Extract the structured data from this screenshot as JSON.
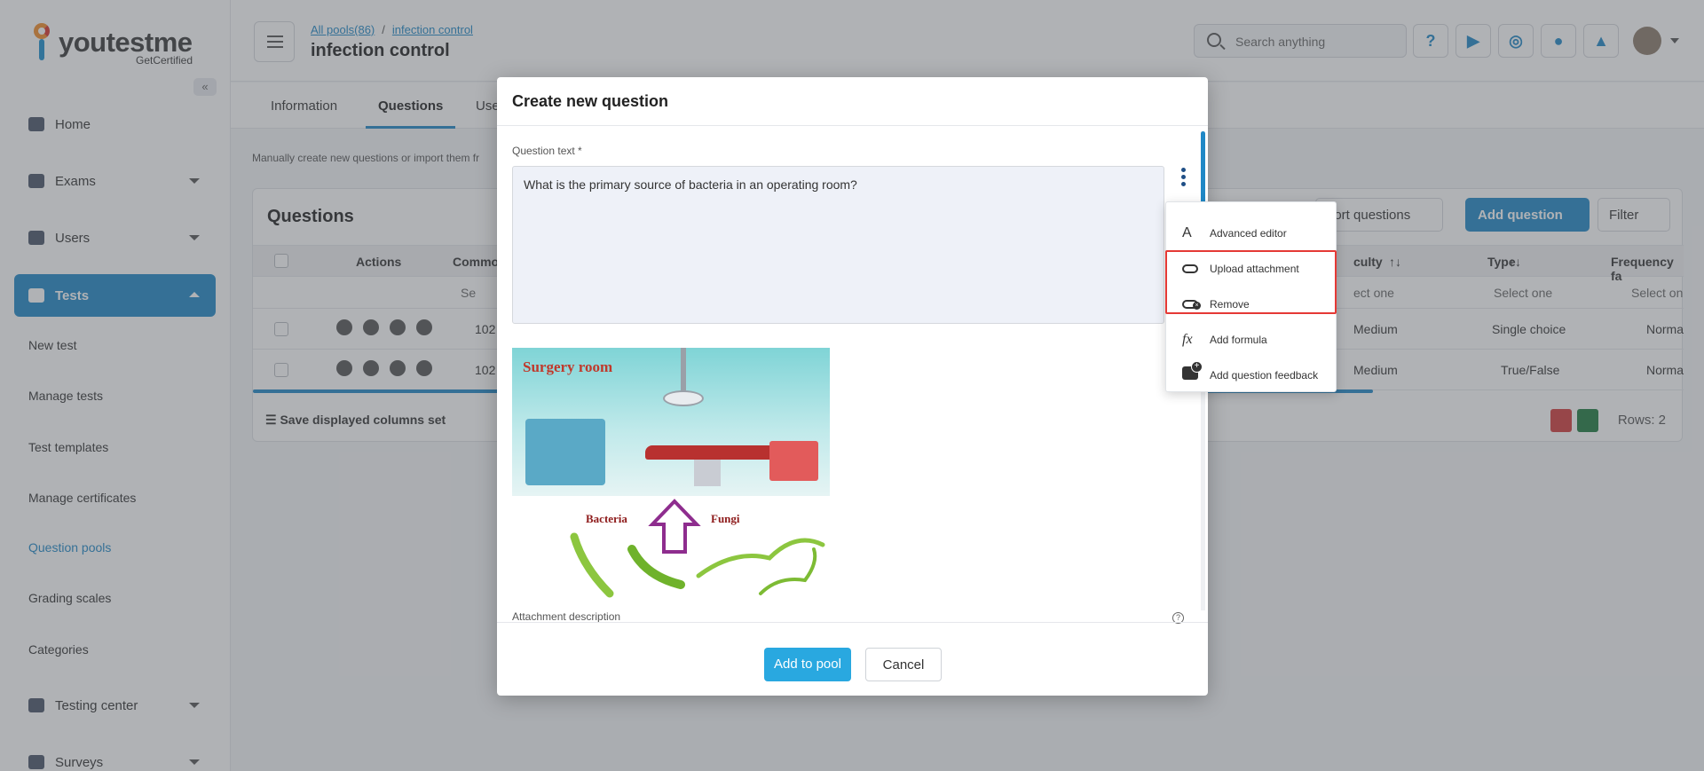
{
  "app": {
    "logo_text": "youtestme",
    "logo_sub": "GetCertified"
  },
  "sidebar": {
    "items": [
      {
        "label": "Home",
        "icon": "home-icon"
      },
      {
        "label": "Exams",
        "icon": "exams-icon"
      },
      {
        "label": "Users",
        "icon": "users-icon"
      },
      {
        "label": "Tests",
        "icon": "tests-icon"
      }
    ],
    "sub_items": [
      {
        "label": "New test"
      },
      {
        "label": "Manage tests"
      },
      {
        "label": "Test templates"
      },
      {
        "label": "Manage certificates"
      },
      {
        "label": "Question pools"
      },
      {
        "label": "Grading scales"
      },
      {
        "label": "Categories"
      }
    ],
    "bottom_items": [
      {
        "label": "Testing center",
        "icon": "testing-center-icon"
      },
      {
        "label": "Surveys",
        "icon": "surveys-icon"
      }
    ],
    "collapse_glyph": "«"
  },
  "header": {
    "breadcrumb": [
      "All pools(86)",
      "infection control"
    ],
    "breadcrumb_sep": "/",
    "title": "infection control",
    "search_placeholder": "Search anything",
    "help_glyph": "?"
  },
  "tabs": [
    "Information",
    "Questions",
    "Use"
  ],
  "page": {
    "hint": "Manually create new questions or import them fr"
  },
  "questions_table": {
    "title": "Questions",
    "import_label": "port questions",
    "add_label": "Add question",
    "filter_label": "Filter",
    "columns": [
      "Actions",
      "Commo",
      "culty",
      "Type",
      "Frequency fa"
    ],
    "sort_glyph": "↑↓",
    "search_placeholder": "Se",
    "select_one": "Select one",
    "select_one_partial": "ect one",
    "select_one_partial2": "Select on",
    "rows": [
      {
        "id": "102",
        "difficulty": "Medium",
        "type": "Single choice",
        "frequency": "Norma"
      },
      {
        "id": "102",
        "difficulty": "Medium",
        "type": "True/False",
        "frequency": "Norma"
      }
    ],
    "footer_label": "Save displayed columns set",
    "rows_count": "Rows: 2"
  },
  "modal": {
    "title": "Create new question",
    "question_label": "Question text *",
    "question_text": "What is the primary source of bacteria in an operating room?",
    "attachment": {
      "title": "Surgery room",
      "label_left": "Bacteria",
      "label_right": "Fungi"
    },
    "attachment_desc_label": "Attachment description",
    "help_glyph": "?",
    "add_button": "Add to pool",
    "cancel_button": "Cancel"
  },
  "context_menu": {
    "items": [
      {
        "label": "Advanced editor",
        "icon": "advanced-editor-icon",
        "glyph": "A"
      },
      {
        "label": "Upload attachment",
        "icon": "link-icon"
      },
      {
        "label": "Remove",
        "icon": "remove-link-icon"
      },
      {
        "label": "Add formula",
        "icon": "formula-icon",
        "glyph": "fx"
      },
      {
        "label": "Add question feedback",
        "icon": "feedback-icon"
      }
    ],
    "highlight_color": "#e53935"
  },
  "colors": {
    "accent": "#1f88c6",
    "primary_button": "#29a8e0"
  }
}
